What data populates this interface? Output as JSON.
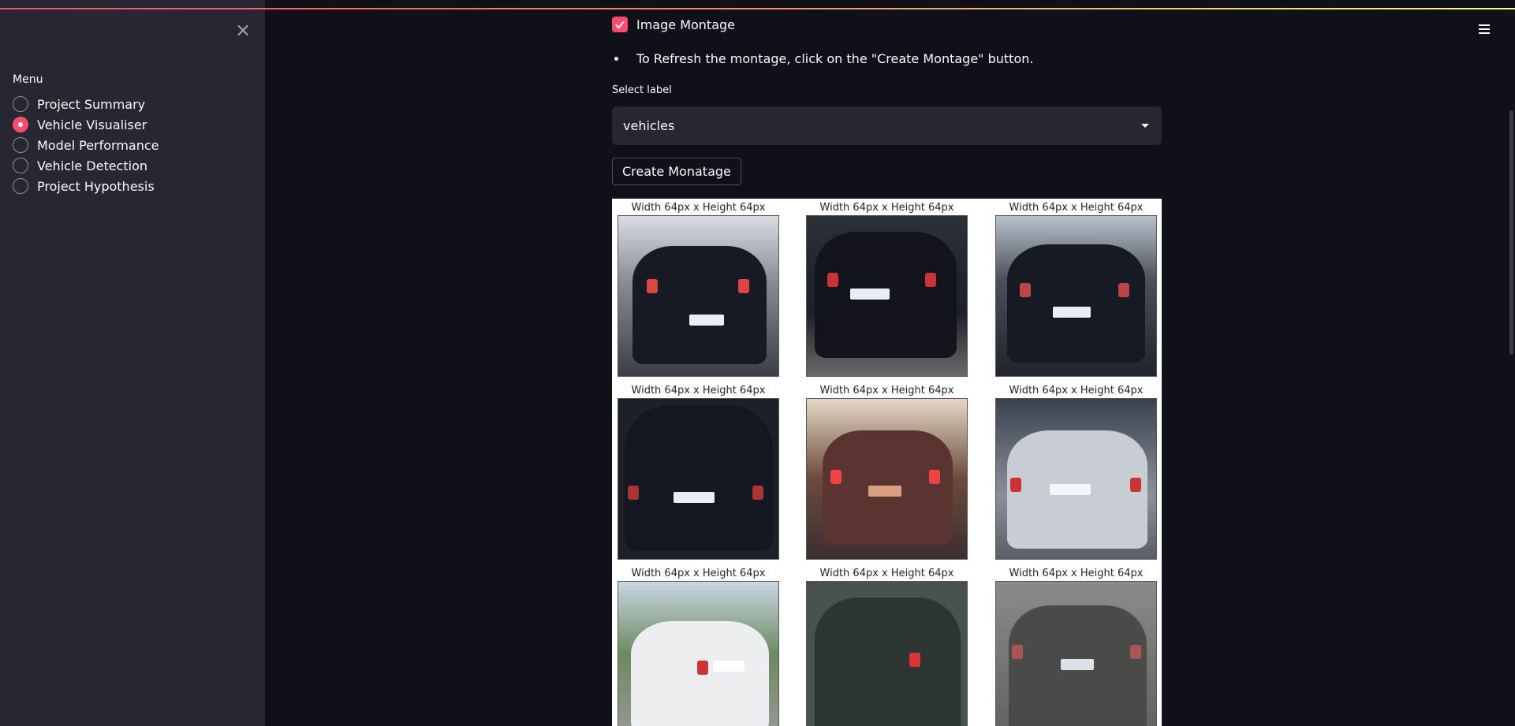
{
  "sidebar": {
    "close_icon": "close-icon",
    "menu_title": "Menu",
    "items": [
      {
        "label": "Project Summary",
        "selected": false
      },
      {
        "label": "Vehicle Visualiser",
        "selected": true
      },
      {
        "label": "Model Performance",
        "selected": false
      },
      {
        "label": "Vehicle Detection",
        "selected": false
      },
      {
        "label": "Project Hypothesis",
        "selected": false
      }
    ]
  },
  "header": {
    "menu_icon": "hamburger-icon"
  },
  "main": {
    "checkbox_label": "Image Montage",
    "checkbox_checked": true,
    "bullet_text": "To Refresh the montage, click on the \"Create Montage\" button.",
    "select_label": "Select label",
    "select_value": "vehicles",
    "button_label": "Create Monatage",
    "montage": {
      "cells": [
        {
          "title": "Width 64px x Height 64px"
        },
        {
          "title": "Width 64px x Height 64px"
        },
        {
          "title": "Width 64px x Height 64px"
        },
        {
          "title": "Width 64px x Height 64px"
        },
        {
          "title": "Width 64px x Height 64px"
        },
        {
          "title": "Width 64px x Height 64px"
        },
        {
          "title": "Width 64px x Height 64px"
        },
        {
          "title": "Width 64px x Height 64px"
        },
        {
          "title": "Width 64px x Height 64px"
        }
      ]
    }
  },
  "colors": {
    "accent": "#ff4b6e",
    "sidebar_bg": "#262730",
    "main_bg": "#0e1117"
  }
}
